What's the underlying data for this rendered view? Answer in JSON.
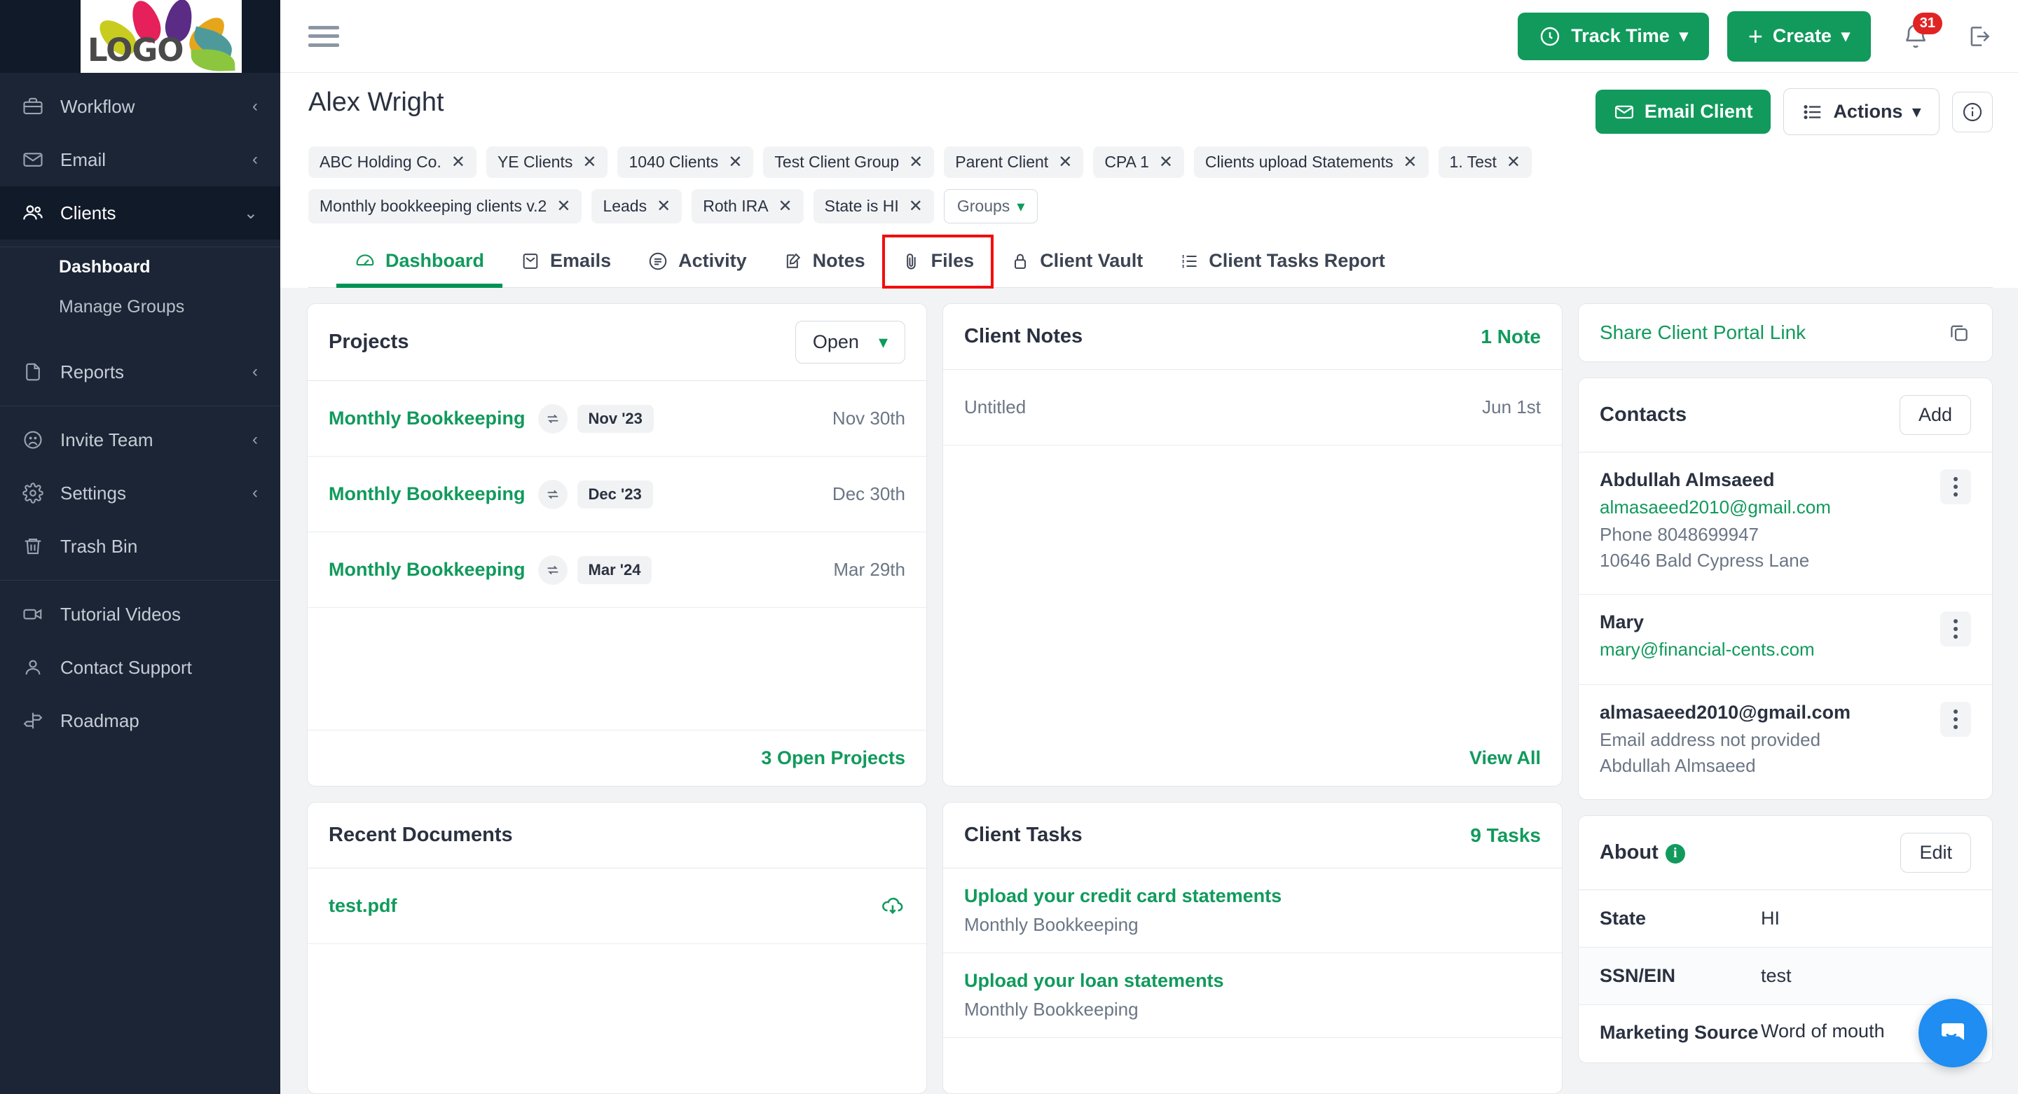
{
  "sidebar": {
    "logo_text": "LOGO",
    "groups": [
      {
        "items": [
          {
            "label": "Workflow",
            "icon": "briefcase-icon",
            "chevron": "‹"
          },
          {
            "label": "Email",
            "icon": "envelope-icon",
            "chevron": "‹"
          },
          {
            "label": "Clients",
            "icon": "users-icon",
            "chevron": "⌄",
            "active": true
          }
        ]
      },
      {
        "subitems": [
          {
            "label": "Dashboard",
            "current": true
          },
          {
            "label": "Manage Groups",
            "current": false
          }
        ]
      },
      {
        "items": [
          {
            "label": "Reports",
            "icon": "file-icon",
            "chevron": "‹"
          }
        ]
      },
      {
        "items": [
          {
            "label": "Invite Team",
            "icon": "invite-icon",
            "chevron": "‹"
          },
          {
            "label": "Settings",
            "icon": "gear-icon",
            "chevron": "‹"
          },
          {
            "label": "Trash Bin",
            "icon": "trash-icon",
            "chevron": ""
          }
        ]
      },
      {
        "items": [
          {
            "label": "Tutorial Videos",
            "icon": "video-icon",
            "chevron": ""
          },
          {
            "label": "Contact Support",
            "icon": "person-icon",
            "chevron": ""
          },
          {
            "label": "Roadmap",
            "icon": "signpost-icon",
            "chevron": ""
          }
        ]
      }
    ]
  },
  "topbar": {
    "menu_icon": "hamburger-icon",
    "track_time_label": "Track Time",
    "create_label": "Create",
    "notification_count": "31",
    "bell_icon": "bell-icon",
    "logout_icon": "logout-icon"
  },
  "client_header": {
    "name": "Alex Wright",
    "email_client_label": "Email Client",
    "actions_label": "Actions",
    "info_icon": "info-circle-icon",
    "tags_row1": [
      "ABC Holding Co.",
      "YE Clients",
      "1040 Clients",
      "Test Client Group",
      "Parent Client",
      "CPA 1",
      "Clients upload Statements",
      "1. Test"
    ],
    "tags_row2": [
      "Monthly bookkeeping clients v.2",
      "Leads",
      "Roth IRA",
      "State is HI"
    ],
    "groups_button_label": "Groups"
  },
  "tabs": [
    {
      "label": "Dashboard",
      "icon": "dashboard-icon",
      "active": true,
      "highlighted": false
    },
    {
      "label": "Emails",
      "icon": "envelope-icon",
      "active": false,
      "highlighted": false
    },
    {
      "label": "Activity",
      "icon": "activity-icon",
      "active": false,
      "highlighted": false
    },
    {
      "label": "Notes",
      "icon": "notes-icon",
      "active": false,
      "highlighted": false
    },
    {
      "label": "Files",
      "icon": "paperclip-icon",
      "active": false,
      "highlighted": true
    },
    {
      "label": "Client Vault",
      "icon": "lock-icon",
      "active": false,
      "highlighted": false
    },
    {
      "label": "Client Tasks Report",
      "icon": "list-icon",
      "active": false,
      "highlighted": false
    }
  ],
  "projects_card": {
    "title": "Projects",
    "filter_value": "Open",
    "rows": [
      {
        "name": "Monthly Bookkeeping",
        "period": "Nov '23",
        "due": "Nov 30th"
      },
      {
        "name": "Monthly Bookkeeping",
        "period": "Dec '23",
        "due": "Dec 30th"
      },
      {
        "name": "Monthly Bookkeeping",
        "period": "Mar '24",
        "due": "Mar 29th"
      }
    ],
    "footer_link": "3 Open Projects"
  },
  "notes_card": {
    "title": "Client Notes",
    "count_label": "1 Note",
    "rows": [
      {
        "title": "Untitled",
        "date": "Jun 1st"
      }
    ],
    "footer_link": "View All"
  },
  "documents_card": {
    "title": "Recent Documents",
    "rows": [
      {
        "name": "test.pdf",
        "action_icon": "cloud-download-icon"
      }
    ]
  },
  "tasks_card": {
    "title": "Client Tasks",
    "count_label": "9 Tasks",
    "rows": [
      {
        "title": "Upload your credit card statements",
        "subtitle": "Monthly Bookkeeping"
      },
      {
        "title": "Upload your loan statements",
        "subtitle": "Monthly Bookkeeping"
      }
    ]
  },
  "portal_card": {
    "label": "Share Client Portal Link",
    "copy_icon": "copy-icon"
  },
  "contacts_card": {
    "title": "Contacts",
    "add_label": "Add",
    "contacts": [
      {
        "name": "Abdullah Almsaeed",
        "email": "almasaeed2010@gmail.com",
        "line2": "Phone 8048699947",
        "line3": "10646 Bald Cypress Lane"
      },
      {
        "name": "Mary",
        "email": "mary@financial-cents.com",
        "line2": "",
        "line3": ""
      },
      {
        "name": "almasaeed2010@gmail.com",
        "email": "",
        "line2": "Email address not provided",
        "line3": "Abdullah Almsaeed"
      }
    ]
  },
  "about_card": {
    "title": "About",
    "edit_label": "Edit",
    "info_icon": "info-icon",
    "rows": [
      {
        "label": "State",
        "value": "HI"
      },
      {
        "label": "SSN/EIN",
        "value": "test"
      },
      {
        "label": "Marketing Source",
        "value": "Word of mouth"
      }
    ]
  },
  "chat_widget": {
    "icon": "chat-bubble-icon"
  },
  "colors": {
    "accent_green": "#119a5c",
    "sidebar_bg": "#1b2535",
    "sidebar_active": "#111a28",
    "badge_red": "#e02424",
    "highlight_red": "#f40d0d",
    "chat_blue": "#1f8df1"
  }
}
